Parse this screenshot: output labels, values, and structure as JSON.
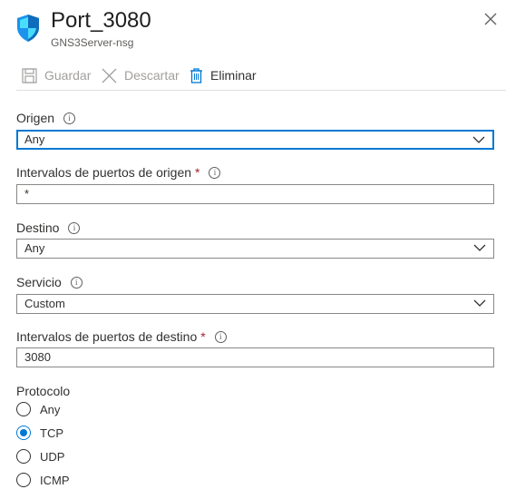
{
  "header": {
    "title": "Port_3080",
    "subtitle": "GNS3Server-nsg"
  },
  "toolbar": {
    "save_label": "Guardar",
    "discard_label": "Descartar",
    "delete_label": "Eliminar"
  },
  "form": {
    "origen_label": "Origen",
    "origen_value": "Any",
    "source_ports_label": "Intervalos de puertos de origen",
    "source_ports_value": "*",
    "destino_label": "Destino",
    "destino_value": "Any",
    "servicio_label": "Servicio",
    "servicio_value": "Custom",
    "dest_ports_label": "Intervalos de puertos de destino",
    "dest_ports_value": "3080",
    "required_mark": "*",
    "protocol_label": "Protocolo",
    "protocol_options": [
      "Any",
      "TCP",
      "UDP",
      "ICMP"
    ],
    "protocol_selected": "TCP"
  },
  "icons": {
    "info_glyph": "i"
  },
  "colors": {
    "accent": "#0078d4",
    "required": "#a4262c",
    "border": "#8a8886"
  }
}
